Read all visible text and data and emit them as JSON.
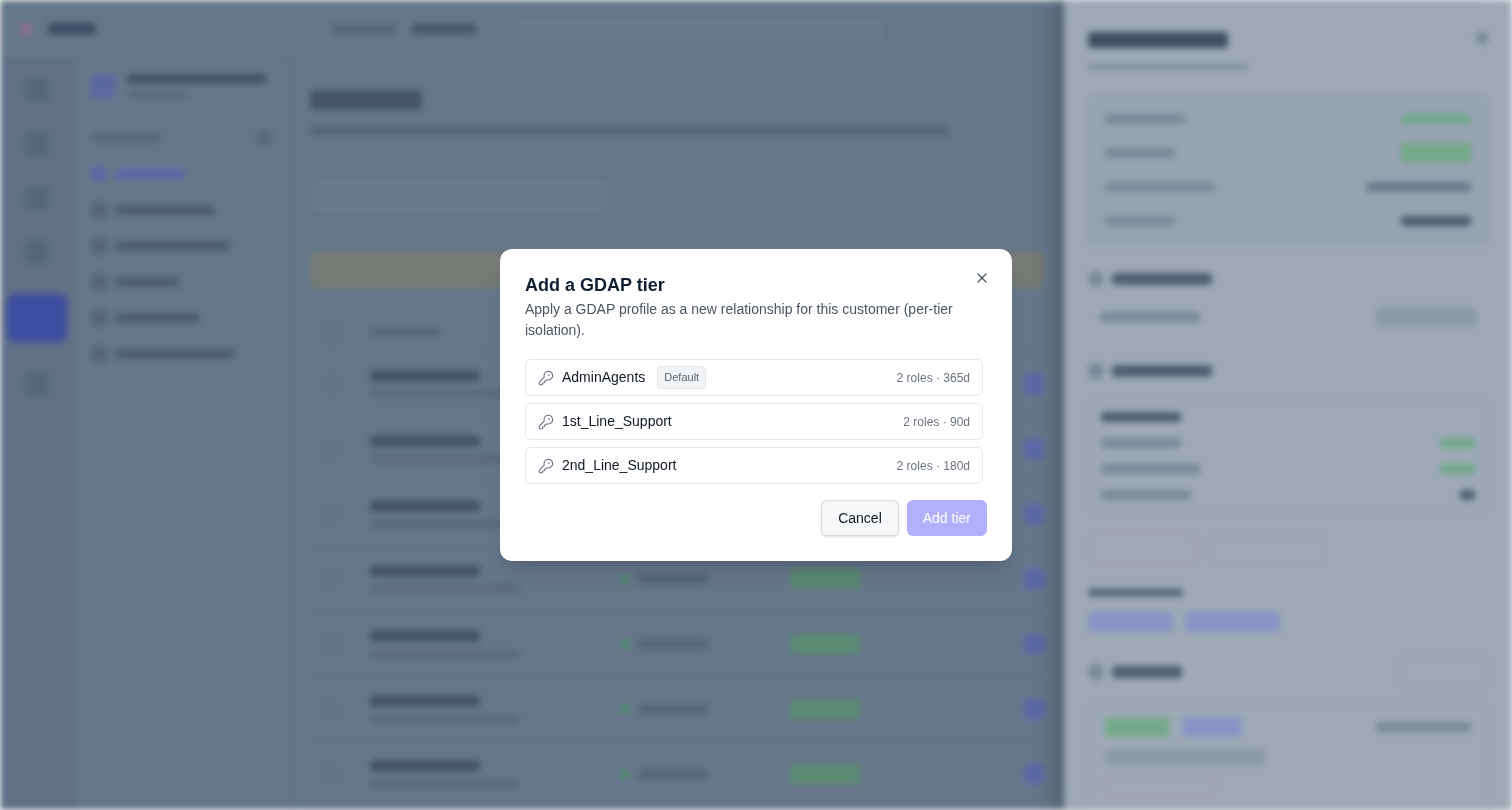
{
  "dialog": {
    "title": "Add a GDAP tier",
    "description": "Apply a GDAP profile as a new relationship for this customer (per-tier isolation).",
    "profiles": [
      {
        "name": "AdminAgents",
        "badge": "Default",
        "meta": "2 roles · 365d",
        "selected": false
      },
      {
        "name": "1st_Line_Support",
        "meta": "2 roles · 90d",
        "selected": false
      },
      {
        "name": "2nd_Line_Support",
        "meta": "2 roles · 180d",
        "selected": false
      }
    ],
    "buttons": [
      {
        "label": "Cancel",
        "kind": "secondary",
        "disabled": false
      },
      {
        "label": "Add tier",
        "kind": "primary",
        "disabled": true
      }
    ]
  }
}
